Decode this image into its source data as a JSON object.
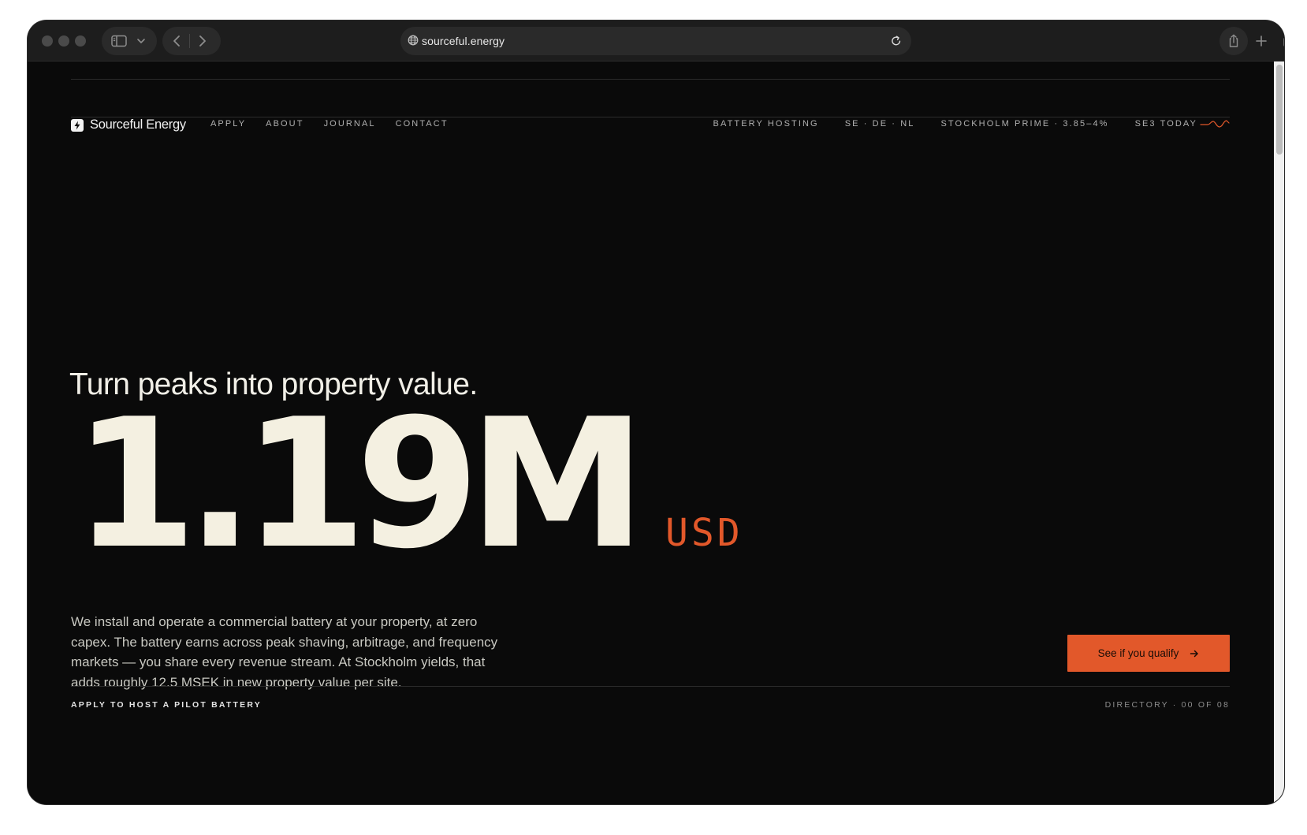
{
  "browser": {
    "url": "sourceful.energy"
  },
  "nav": {
    "brand": "Sourceful Energy",
    "links": [
      {
        "label": "APPLY"
      },
      {
        "label": "ABOUT"
      },
      {
        "label": "JOURNAL"
      },
      {
        "label": "CONTACT"
      }
    ],
    "meta": [
      {
        "label": "BATTERY HOSTING"
      },
      {
        "label": "SE · DE · NL"
      },
      {
        "label": "STOCKHOLM PRIME · 3.85–4%"
      },
      {
        "label": "SE3 TODAY"
      }
    ]
  },
  "hero": {
    "tagline": "Turn peaks into property value.",
    "value": "1.19M",
    "currency": "USD",
    "description": "We install and operate a commercial battery at your property, at zero capex. The battery earns across peak shaving, arbitrage, and frequency markets — you share every revenue stream. At Stockholm yields, that adds roughly 12.5 MSEK in new property value per site.",
    "cta_label": "See if you qualify"
  },
  "footer": {
    "left": "APPLY TO HOST A PILOT BATTERY",
    "right": "DIRECTORY · 00 OF 08"
  },
  "colors": {
    "accent": "#e2582a",
    "background": "#0a0a0a",
    "hero_text": "#f4f0e1"
  },
  "icons": {
    "brand_logo": "lightning-bolt-icon",
    "cta": "arrow-right-icon",
    "sparkline": "sparkline-icon"
  }
}
